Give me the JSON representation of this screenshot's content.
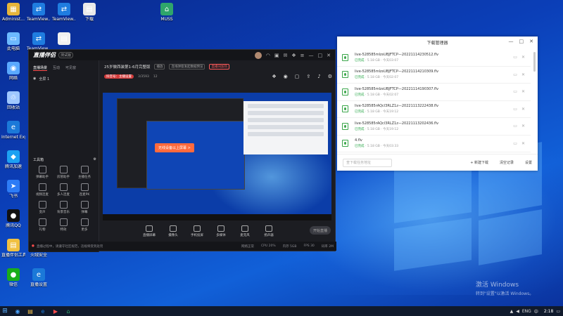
{
  "desktop": {
    "icons": [
      {
        "label": "Administ...",
        "glyph": "▦",
        "color": "#e6b53b"
      },
      {
        "label": "TeamView...",
        "glyph": "⇄",
        "color": "#1f7de0"
      },
      {
        "label": "TeamView...",
        "glyph": "⇄",
        "color": "#1f7de0"
      },
      {
        "label": "下载",
        "glyph": "▤",
        "color": "#e9e9e9"
      },
      {
        "label": "MUSS",
        "glyph": "⌂",
        "color": "#2fa56b"
      },
      {
        "label": "此电脑",
        "glyph": "▭",
        "color": "#6cb9ff"
      },
      {
        "label": "TeamView...",
        "glyph": "⇄",
        "color": "#1f7de0"
      },
      {
        "label": "",
        "glyph": "▤",
        "color": "#f0f0f0"
      },
      {
        "label": "网络",
        "glyph": "◉",
        "color": "#5aa9ff"
      },
      {
        "label": "回收站",
        "glyph": "♲",
        "color": "#9fc7ff"
      },
      {
        "label": "Internet Explorer",
        "glyph": "e",
        "color": "#1b79d8"
      },
      {
        "label": "腾讯加速",
        "glyph": "◆",
        "color": "#1da1f2"
      },
      {
        "label": "飞书",
        "glyph": "➤",
        "color": "#2d7cf6"
      },
      {
        "label": "腾讯QQ",
        "glyph": "●",
        "color": "#111111"
      },
      {
        "label": "直播伴侣工具",
        "glyph": "▤",
        "color": "#f0c040"
      },
      {
        "label": "火绒安全",
        "glyph": "▣",
        "color": "#f3a43b"
      },
      {
        "label": "微信",
        "glyph": "●",
        "color": "#1aad19"
      },
      {
        "label": "直播设置",
        "glyph": "e",
        "color": "#1b79d8"
      }
    ],
    "watermark_line1": "激活 Windows",
    "watermark_line2": "转到\"设置\"以激活 Windows。"
  },
  "live_app": {
    "logo": "直播伴侣",
    "beta": "测试版",
    "left_tabs": [
      "直播场景",
      "互动",
      "可见窗"
    ],
    "scene_label": "全屏 1",
    "toolbox_title": "工具箱",
    "tools": [
      "弹幕助手",
      "房管助手",
      "主播任务",
      "视频连麦",
      "多人连麦",
      "连麦PK",
      "变声",
      "背景音乐",
      "弹幕",
      "礼物",
      "特效",
      "更多"
    ],
    "stream_title": "25岁做西装第1-6月完整版",
    "stream_tags": [
      "播放",
      "连线弹窗发起数据预览",
      "直播间加热"
    ],
    "sub_info": [
      "3/3593",
      "12"
    ],
    "sub_badge": "抖音号：主播设置",
    "toast": "无线设备以上屏幕 >",
    "controls": [
      "直播屏幕",
      "摄像头",
      "手机投屏",
      "多媒体",
      "麦克风",
      "扬声器"
    ],
    "live_button": "开始直播",
    "status_warn": "直播过程中，请遵守社区规范，违规将受到处罚",
    "status_stats": [
      "网络正常",
      "CPU 20%",
      "内存 5GB",
      "FPS 30",
      "码率 2M"
    ]
  },
  "download_manager": {
    "title": "下载管理器",
    "items": [
      {
        "name": "live-528585mIzsUBJFTCP—20221114230512.flv",
        "status": "已完成",
        "size": "5.18 GB",
        "time": "今天03:07"
      },
      {
        "name": "live-528585mIzsUBJFTCP—20221114210309.flv",
        "status": "已完成",
        "size": "5.18 GB",
        "time": "今天02:07"
      },
      {
        "name": "live-528585mIzsUBJFTCP—20221114190307.flv",
        "status": "已完成",
        "size": "5.18 GB",
        "time": "今天02:07"
      },
      {
        "name": "live-528585rAQcl3RLZ1z—20221113222438.flv",
        "status": "已完成",
        "size": "5.18 GB",
        "time": "今天19:12"
      },
      {
        "name": "live-528585rAQcl3RLZ1z—20221113202436.flv",
        "status": "已完成",
        "size": "5.18 GB",
        "time": "今天19:12"
      },
      {
        "name": "4.flv",
        "status": "已完成",
        "size": "5.18 GB",
        "time": "今天03:33"
      }
    ],
    "search_placeholder": "查下载任务地址",
    "buttons": [
      "+ 新建下载",
      "清空记录",
      "设置"
    ]
  },
  "taskbar": {
    "tray": [
      "ENG",
      "中"
    ],
    "clock": "2:18"
  }
}
